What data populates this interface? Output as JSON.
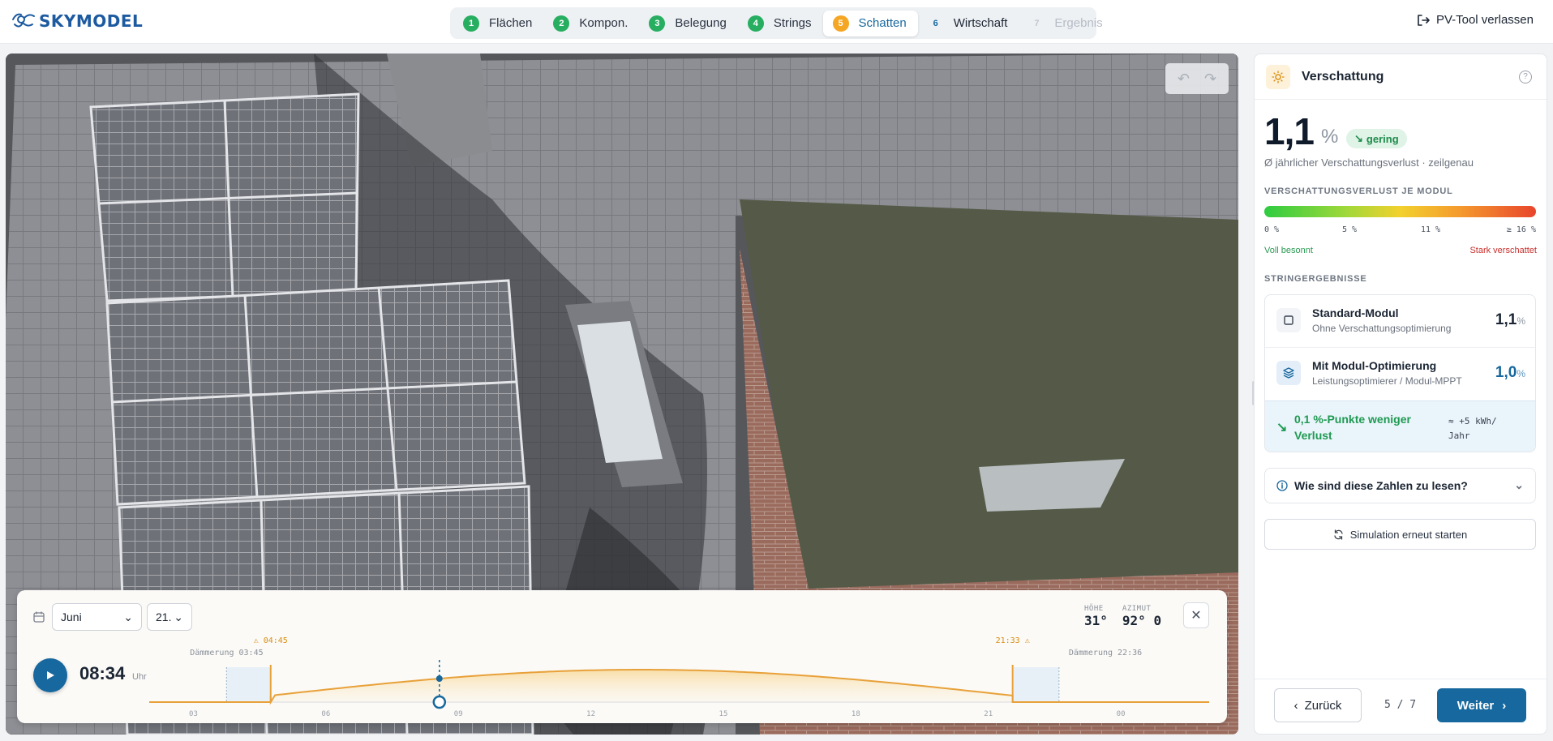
{
  "header": {
    "brand": "SKYMODEL",
    "steps": [
      {
        "num": "1",
        "label": "Flächen"
      },
      {
        "num": "2",
        "label": "Kompon."
      },
      {
        "num": "3",
        "label": "Belegung"
      },
      {
        "num": "4",
        "label": "Strings"
      },
      {
        "num": "5",
        "label": "Schatten"
      },
      {
        "num": "6",
        "label": "Wirtschaft"
      },
      {
        "num": "7",
        "label": "Ergebnis"
      }
    ],
    "active_step": 5,
    "exit_label": "PV-Tool verlassen"
  },
  "timeline": {
    "month": "Juni",
    "day": "21.",
    "elevation_label": "HÖHE",
    "elevation_value": "31°",
    "azimuth_label": "AZIMUT",
    "azimuth_value": "92° 0",
    "time": "08:34",
    "time_unit": "Uhr",
    "sunrise": "04:45",
    "sunset": "21:33",
    "dawn": "Dämmerung 03:45",
    "dusk": "Dämmerung 22:36",
    "hour_ticks": [
      "03",
      "06",
      "09",
      "12",
      "15",
      "18",
      "21",
      "00"
    ],
    "current_hour": 8.57
  },
  "panel": {
    "title": "Verschattung",
    "help": "?",
    "total_value": "1,1",
    "total_unit": "%",
    "badge": "gering",
    "subline": "Ø jährlicher Verschattungsverlust · zeilgenau",
    "per_module_label": "VERSCHATTUNGSVERLUST JE MODUL",
    "scale_ticks": [
      "0 %",
      "5 %",
      "11 %",
      "≥ 16 %"
    ],
    "legend_low": "Voll besonnt",
    "legend_high": "Stark verschattet",
    "strings_label": "STRINGERGEBNISSE",
    "rows": [
      {
        "title": "Standard-Modul",
        "sub": "Ohne Verschattungsoptimierung",
        "value": "1,1",
        "unit": "%"
      },
      {
        "title": "Mit Modul-Optimierung",
        "sub": "Leistungsoptimierer / Modul-MPPT",
        "value": "1,0",
        "unit": "%"
      }
    ],
    "savings_text": "0,1 %-Punkte weniger Verlust",
    "savings_kwh": "≈ +5 kWh/ Jahr",
    "accordion_label": "Wie sind diese Zahlen zu lesen?",
    "rerun_label": "Simulation erneut starten",
    "back_label": "Zurück",
    "pager": "5 / 7",
    "next_label": "Weiter"
  },
  "colors": {
    "brand": "#1d5aa0",
    "primary": "#17689e",
    "accent_orange": "#f5a623",
    "step_green": "#27ae60",
    "good": "#1f9a52",
    "bad": "#c9302c"
  }
}
